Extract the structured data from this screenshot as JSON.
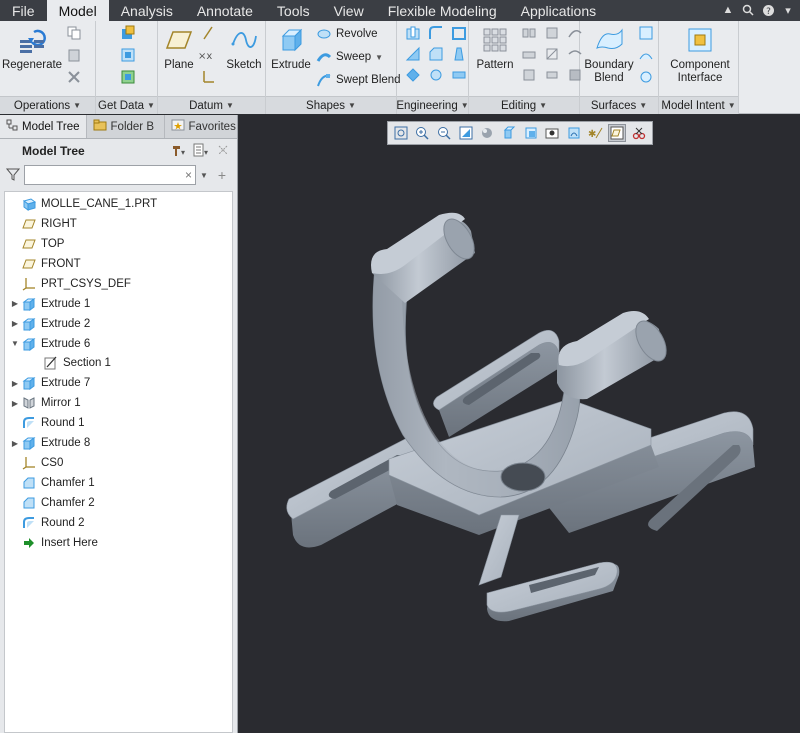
{
  "menubar": {
    "tabs": [
      "File",
      "Model",
      "Analysis",
      "Annotate",
      "Tools",
      "View",
      "Flexible Modeling",
      "Applications"
    ],
    "active": "Model"
  },
  "ribbon": {
    "operations": {
      "label": "Operations",
      "regenerate": "Regenerate"
    },
    "get_data": {
      "label": "Get Data"
    },
    "datum": {
      "label": "Datum",
      "plane": "Plane",
      "sketch": "Sketch"
    },
    "shapes": {
      "label": "Shapes",
      "extrude": "Extrude",
      "revolve": "Revolve",
      "sweep": "Sweep",
      "swept_blend": "Swept Blend"
    },
    "engineering": {
      "label": "Engineering"
    },
    "editing": {
      "label": "Editing",
      "pattern": "Pattern"
    },
    "surfaces": {
      "label": "Surfaces",
      "boundary_blend_1": "Boundary",
      "boundary_blend_2": "Blend"
    },
    "model_intent": {
      "label": "Model Intent",
      "component_interface_1": "Component",
      "component_interface_2": "Interface"
    }
  },
  "panel": {
    "tabs": [
      "Model Tree",
      "Folder B",
      "Favorites"
    ],
    "tree_title": "Model Tree",
    "search_value": ""
  },
  "tree": {
    "items": [
      {
        "label": "MOLLE_CANE_1.PRT",
        "icon": "part-icon",
        "expander": ""
      },
      {
        "label": "RIGHT",
        "icon": "datum-plane-icon",
        "expander": ""
      },
      {
        "label": "TOP",
        "icon": "datum-plane-icon",
        "expander": ""
      },
      {
        "label": "FRONT",
        "icon": "datum-plane-icon",
        "expander": ""
      },
      {
        "label": "PRT_CSYS_DEF",
        "icon": "csys-icon",
        "expander": ""
      },
      {
        "label": "Extrude 1",
        "icon": "extrude-icon",
        "expander": "collapsed"
      },
      {
        "label": "Extrude 2",
        "icon": "extrude-icon",
        "expander": "collapsed"
      },
      {
        "label": "Extrude 6",
        "icon": "extrude-icon",
        "expander": "expanded"
      },
      {
        "label": "Section 1",
        "icon": "section-icon",
        "expander": "",
        "indent": 1
      },
      {
        "label": "Extrude 7",
        "icon": "extrude-icon",
        "expander": "collapsed"
      },
      {
        "label": "Mirror 1",
        "icon": "mirror-icon",
        "expander": "collapsed"
      },
      {
        "label": "Round 1",
        "icon": "round-icon",
        "expander": ""
      },
      {
        "label": "Extrude 8",
        "icon": "extrude-icon",
        "expander": "collapsed"
      },
      {
        "label": "CS0",
        "icon": "csys-icon",
        "expander": ""
      },
      {
        "label": "Chamfer 1",
        "icon": "chamfer-icon",
        "expander": ""
      },
      {
        "label": "Chamfer 2",
        "icon": "chamfer-icon",
        "expander": ""
      },
      {
        "label": "Round 2",
        "icon": "round-icon",
        "expander": ""
      },
      {
        "label": "Insert Here",
        "icon": "insert-arrow-icon",
        "expander": ""
      }
    ]
  },
  "view_toolbar": {
    "icons": [
      "refit-icon",
      "zoom-in-icon",
      "zoom-out-icon",
      "repaint-icon",
      "display-style-icon",
      "saved-views-icon",
      "view-manager-icon",
      "perspective-icon",
      "spin-center-icon",
      "annotation-display-icon",
      "datum-display-icon",
      "section-icon"
    ]
  },
  "colors": {
    "accent_tab": "#e9ebee",
    "menubar": "#3b3e44",
    "viewport": "#2a2b30",
    "model": "#9ea7b2"
  }
}
